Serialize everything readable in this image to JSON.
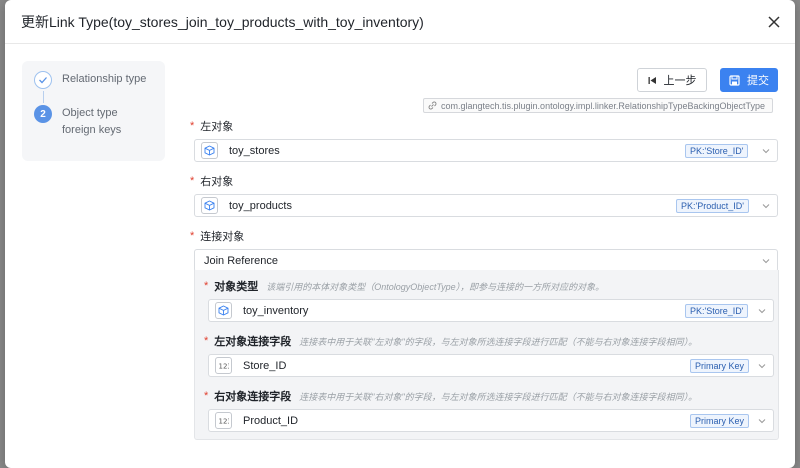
{
  "dialog": {
    "title": "更新Link Type(toy_stores_join_toy_products_with_toy_inventory)"
  },
  "steps": [
    {
      "label": "Relationship type",
      "state": "done",
      "number": ""
    },
    {
      "label_line1": "Object type",
      "label_line2": "foreign keys",
      "state": "active",
      "number": "2"
    }
  ],
  "actions": {
    "prev_label": "上一步",
    "submit_label": "提交"
  },
  "backing_class": "com.glangtech.tis.plugin.ontology.impl.linker.RelationshipTypeBackingObjectType",
  "fields": {
    "left_object": {
      "required": "*",
      "label": "左对象",
      "value": "toy_stores",
      "badge": "PK:'Store_ID'"
    },
    "right_object": {
      "required": "*",
      "label": "右对象",
      "value": "toy_products",
      "badge": "PK:'Product_ID'"
    },
    "join_object": {
      "required": "*",
      "label": "连接对象",
      "value": "Join Reference"
    }
  },
  "join_reference": {
    "object_type": {
      "required": "*",
      "label": "对象类型",
      "hint": "该端引用的本体对象类型（OntologyObjectType），即参与连接的一方所对应的对象。",
      "value": "toy_inventory",
      "badge": "PK:'Store_ID'"
    },
    "left_join_field": {
      "required": "*",
      "label": "左对象连接字段",
      "hint": "连接表中用于关联\"左对象\"的字段，与左对象所选连接字段进行匹配（不能与右对象连接字段相同）。",
      "value": "Store_ID",
      "badge": "Primary Key"
    },
    "right_join_field": {
      "required": "*",
      "label": "右对象连接字段",
      "hint": "连接表中用于关联\"右对象\"的字段，与左对象所选连接字段进行匹配（不能与右对象连接字段相同）。",
      "value": "Product_ID",
      "badge": "Primary Key"
    }
  },
  "colors": {
    "primary": "#3b82f0",
    "required": "#e03e2d",
    "badge_border": "#a9c6ef"
  },
  "icons": {
    "close": "close-icon",
    "step_done": "check-icon",
    "prev": "skip-back-icon",
    "submit": "save-icon",
    "link": "link-icon",
    "object": "cube-icon",
    "field": "number-field-icon",
    "chevron": "chevron-down-icon"
  }
}
